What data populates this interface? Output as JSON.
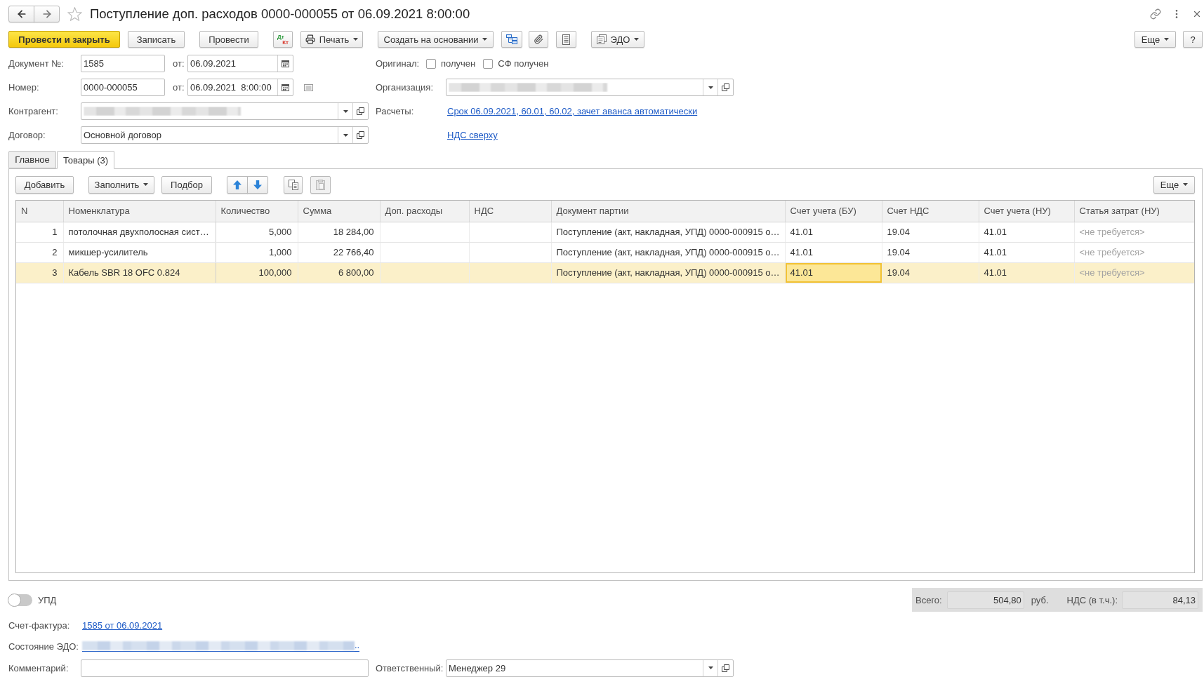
{
  "window": {
    "title": "Поступление доп. расходов 0000-000055 от 06.09.2021 8:00:00",
    "favorite": false
  },
  "toolbar": {
    "post_and_close": "Провести и закрыть",
    "save": "Записать",
    "post": "Провести",
    "dt_kt": {
      "debit": "Дт",
      "credit": "Кт"
    },
    "print": "Печать",
    "create_based_on": "Создать на основании",
    "edo": "ЭДО",
    "more": "Еще",
    "help": "?"
  },
  "header": {
    "document_number": {
      "label": "Документ №:",
      "value": "1585",
      "date_label": "от:",
      "date": "06.09.2021"
    },
    "number": {
      "label": "Номер:",
      "value": "0000-000055",
      "date_label": "от:",
      "date": "06.09.2021  8:00:00"
    },
    "counterparty": {
      "label": "Контрагент:",
      "redacted": true
    },
    "contract": {
      "label": "Договор:",
      "value": "Основной договор"
    },
    "original": {
      "label": "Оригинал:",
      "checkboxes": [
        {
          "label": "получен",
          "checked": false
        },
        {
          "label": "СФ получен",
          "checked": false
        }
      ]
    },
    "organization": {
      "label": "Организация:",
      "redacted": true
    },
    "settlements": {
      "label": "Расчеты:",
      "link": "Срок 06.09.2021, 60.01, 60.02, зачет аванса автоматически"
    },
    "vat_link": "НДС сверху"
  },
  "tabs": [
    {
      "label": "Главное",
      "selected": false
    },
    {
      "label": "Товары (3)",
      "selected": true
    }
  ],
  "table_toolbar": {
    "add": "Добавить",
    "fill": "Заполнить",
    "pick": "Подбор",
    "paste_disabled": true,
    "more": "Еще"
  },
  "table": {
    "columns": [
      "N",
      "Номенклатура",
      "Количество",
      "Сумма",
      "Доп. расходы",
      "НДС",
      "Документ партии",
      "Счет учета (БУ)",
      "Счет НДС",
      "Счет учета (НУ)",
      "Статья затрат (НУ)"
    ],
    "rows": [
      {
        "selected": false,
        "n": "1",
        "item": "потолочная двухполосная сист…",
        "quantity": "5,000",
        "amount": "18 284,00",
        "batch_document": "Поступление (акт, накладная, УПД) 0000-000915 о…",
        "account_bu": {
          "text": "41.01",
          "focused": false
        },
        "vat_account": "19.04",
        "account_nu": "41.01",
        "cost_item_placeholder": "<не требуется>"
      },
      {
        "selected": false,
        "n": "2",
        "item": "микшер-усилитель",
        "quantity": "1,000",
        "amount": "22 766,40",
        "batch_document": "Поступление (акт, накладная, УПД) 0000-000915 о…",
        "account_bu": {
          "text": "41.01",
          "focused": false
        },
        "vat_account": "19.04",
        "account_nu": "41.01",
        "cost_item_placeholder": "<не требуется>"
      },
      {
        "selected": true,
        "n": "3",
        "item": "Кабель SBR 18 OFC 0.824",
        "quantity": "100,000",
        "amount": "6 800,00",
        "batch_document": "Поступление (акт, накладная, УПД) 0000-000915 о…",
        "account_bu": {
          "text": "41.01",
          "focused": true
        },
        "vat_account": "19.04",
        "account_nu": "41.01",
        "cost_item_placeholder": "<не требуется>"
      }
    ]
  },
  "upd": {
    "label": "УПД",
    "on": false
  },
  "totals": {
    "total_label": "Всего:",
    "total": "504,80",
    "currency": "руб.",
    "vat_label": "НДС (в т.ч.):",
    "vat": "84,13"
  },
  "invoice": {
    "label": "Счет-фактура:",
    "link": "1585 от 06.09.2021"
  },
  "edo_status": {
    "label": "Состояние ЭДО:",
    "redacted": true,
    "tail": ".."
  },
  "comment": {
    "label": "Комментарий:"
  },
  "responsible": {
    "label": "Ответственный:",
    "value": "Менеджер 29"
  }
}
